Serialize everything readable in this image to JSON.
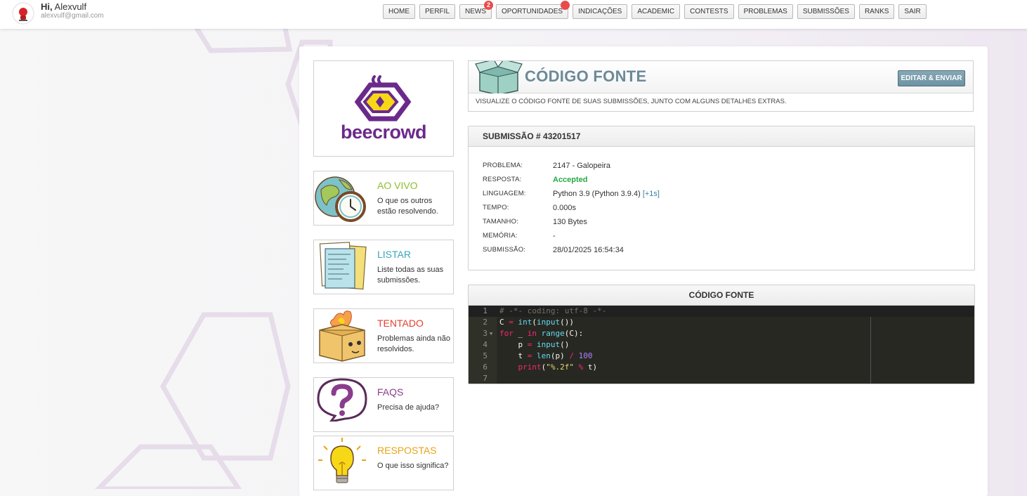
{
  "user": {
    "greeting_prefix": "Hi,",
    "name": "Alexvulf",
    "email": "alexvulf@gmail.com"
  },
  "nav": [
    {
      "label": "HOME"
    },
    {
      "label": "PERFIL"
    },
    {
      "label": "NEWS",
      "badge": "2"
    },
    {
      "label": "OPORTUNIDADES",
      "dot": true
    },
    {
      "label": "INDICAÇÕES"
    },
    {
      "label": "ACADEMIC"
    },
    {
      "label": "CONTESTS"
    },
    {
      "label": "PROBLEMAS"
    },
    {
      "label": "SUBMISSÕES"
    },
    {
      "label": "RANKS"
    },
    {
      "label": "SAIR"
    }
  ],
  "logo": {
    "text": "beecrowd",
    "color": "#6b2a8b"
  },
  "menu_cards": [
    {
      "title": "AO VIVO",
      "desc": "O que os outros estão resolvendo.",
      "color": "#8cbf2f",
      "icon": "globe-clock-icon"
    },
    {
      "title": "LISTAR",
      "desc": "Liste todas as suas submissões.",
      "color": "#3aa6b9",
      "icon": "papers-icon"
    },
    {
      "title": "TENTADO",
      "desc": "Problemas ainda não resolvidos.",
      "color": "#e2412f",
      "icon": "burning-box-icon"
    },
    {
      "title": "FAQS",
      "desc": "Precisa de ajuda?",
      "color": "#8a3d8d",
      "icon": "question-bubble-icon"
    },
    {
      "title": "RESPOSTAS",
      "desc": "O que isso significa?",
      "color": "#e8a317",
      "icon": "lightbulb-icon"
    }
  ],
  "header": {
    "title": "CÓDIGO FONTE",
    "button": "EDITAR & ENVIAR",
    "subtitle": "VISUALIZE O CÓDIGO FONTE DE SUAS SUBMISSÕES, JUNTO COM ALGUNS DETALHES EXTRAS."
  },
  "submission": {
    "title": "SUBMISSÃO # 43201517",
    "rows": [
      {
        "label": "PROBLEMA:",
        "value": "2147 - Galopeira"
      },
      {
        "label": "RESPOSTA:",
        "value": "Accepted"
      },
      {
        "label": "LINGUAGEM:",
        "value": "Python 3.9 (Python 3.9.4)",
        "extra": "[+1s]"
      },
      {
        "label": "TEMPO:",
        "value": "0.000s"
      },
      {
        "label": "TAMANHO:",
        "value": "130 Bytes"
      },
      {
        "label": "MEMÓRIA:",
        "value": "-"
      },
      {
        "label": "SUBMISSÃO:",
        "value": "28/01/2025 16:54:34"
      }
    ]
  },
  "code": {
    "title": "CÓDIGO FONTE",
    "lines": [
      {
        "n": "1",
        "text": "# -*- coding: utf-8 -*-"
      },
      {
        "n": "2",
        "text": "C = int(input())"
      },
      {
        "n": "3",
        "text": "for _ in range(C):"
      },
      {
        "n": "4",
        "text": "    p = input()"
      },
      {
        "n": "5",
        "text": "    t = len(p) / 100"
      },
      {
        "n": "6",
        "text": "    print(\"%.2f\" % t)"
      },
      {
        "n": "7",
        "text": ""
      }
    ]
  }
}
